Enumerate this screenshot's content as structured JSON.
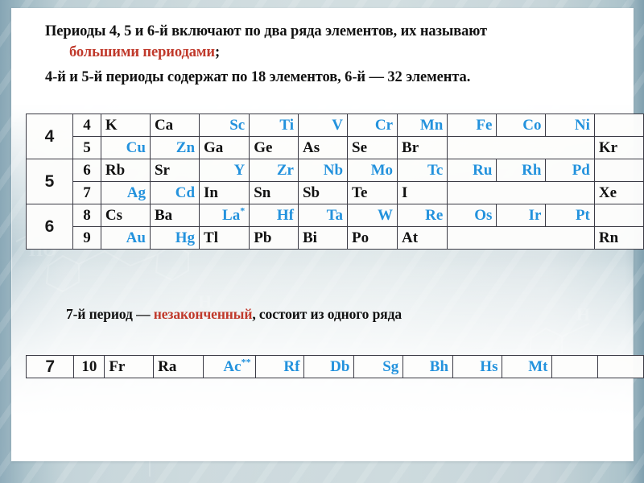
{
  "slide": {
    "colors": {
      "blue_element": "#2392dd",
      "black_element": "#111111",
      "highlight_red": "#c0392b",
      "grid_line": "#3b3b45",
      "background": "#c5d4d8"
    }
  },
  "intro": {
    "line1_a": "Периоды 4, 5 и 6-й включают по два ряда элементов, их называют",
    "line2_red": "большими периодами",
    "line2_tail": ";",
    "line3": "4-й и 5-й периоды содержат по 18 элементов, 6-й — 32 элемента."
  },
  "note7": {
    "prefix": "7-й период — ",
    "red": "незаконченный",
    "suffix": ", состоит из одного ряда"
  },
  "table_main": {
    "periods": [
      "4",
      "5",
      "6"
    ],
    "rows": [
      {
        "period": "4",
        "rownum": "4",
        "cells": [
          {
            "text": "K",
            "color": "black"
          },
          {
            "text": "Ca",
            "color": "black"
          },
          {
            "text": "Sc",
            "color": "blue"
          },
          {
            "text": "Ti",
            "color": "blue"
          },
          {
            "text": "V",
            "color": "blue"
          },
          {
            "text": "Cr",
            "color": "blue"
          },
          {
            "text": "Mn",
            "color": "blue"
          },
          {
            "text": "Fe",
            "color": "blue"
          },
          {
            "text": "Co",
            "color": "blue"
          },
          {
            "text": "Ni",
            "color": "blue"
          },
          {
            "text": "",
            "color": "empty"
          }
        ]
      },
      {
        "period": "",
        "rownum": "5",
        "cells": [
          {
            "text": "Cu",
            "color": "blue"
          },
          {
            "text": "Zn",
            "color": "blue"
          },
          {
            "text": "Ga",
            "color": "black"
          },
          {
            "text": "Ge",
            "color": "black"
          },
          {
            "text": "As",
            "color": "black"
          },
          {
            "text": "Se",
            "color": "black"
          },
          {
            "text": "Br",
            "color": "black"
          },
          {
            "text": "",
            "color": "empty",
            "span": 3
          },
          {
            "text": "Kr",
            "color": "black"
          }
        ]
      },
      {
        "period": "5",
        "rownum": "6",
        "cells": [
          {
            "text": "Rb",
            "color": "black"
          },
          {
            "text": "Sr",
            "color": "black"
          },
          {
            "text": "Y",
            "color": "blue"
          },
          {
            "text": "Zr",
            "color": "blue"
          },
          {
            "text": "Nb",
            "color": "blue"
          },
          {
            "text": "Mo",
            "color": "blue"
          },
          {
            "text": "Tc",
            "color": "blue"
          },
          {
            "text": "Ru",
            "color": "blue"
          },
          {
            "text": "Rh",
            "color": "blue"
          },
          {
            "text": "Pd",
            "color": "blue"
          },
          {
            "text": "",
            "color": "empty"
          }
        ]
      },
      {
        "period": "",
        "rownum": "7",
        "cells": [
          {
            "text": "Ag",
            "color": "blue"
          },
          {
            "text": "Cd",
            "color": "blue"
          },
          {
            "text": "In",
            "color": "black"
          },
          {
            "text": "Sn",
            "color": "black"
          },
          {
            "text": "Sb",
            "color": "black"
          },
          {
            "text": "Te",
            "color": "black"
          },
          {
            "text": "I",
            "color": "black"
          },
          {
            "text": "",
            "color": "empty",
            "span": 3
          },
          {
            "text": "Xe",
            "color": "black"
          }
        ]
      },
      {
        "period": "6",
        "rownum": "8",
        "cells": [
          {
            "text": "Cs",
            "color": "black"
          },
          {
            "text": "Ba",
            "color": "black"
          },
          {
            "text": "La",
            "color": "blue",
            "sup": "*"
          },
          {
            "text": "Hf",
            "color": "blue"
          },
          {
            "text": "Ta",
            "color": "blue"
          },
          {
            "text": "W",
            "color": "blue"
          },
          {
            "text": "Re",
            "color": "blue"
          },
          {
            "text": "Os",
            "color": "blue"
          },
          {
            "text": "Ir",
            "color": "blue"
          },
          {
            "text": "Pt",
            "color": "blue"
          },
          {
            "text": "",
            "color": "empty"
          }
        ]
      },
      {
        "period": "",
        "rownum": "9",
        "cells": [
          {
            "text": "Au",
            "color": "blue"
          },
          {
            "text": "Hg",
            "color": "blue"
          },
          {
            "text": "Tl",
            "color": "black"
          },
          {
            "text": "Pb",
            "color": "black"
          },
          {
            "text": "Bi",
            "color": "black"
          },
          {
            "text": "Po",
            "color": "black"
          },
          {
            "text": "At",
            "color": "black"
          },
          {
            "text": "",
            "color": "empty",
            "span": 3
          },
          {
            "text": "Rn",
            "color": "black"
          }
        ]
      }
    ]
  },
  "table_p7": {
    "rows": [
      {
        "period": "7",
        "rownum": "10",
        "cells": [
          {
            "text": "Fr",
            "color": "black"
          },
          {
            "text": "Ra",
            "color": "black"
          },
          {
            "text": "Ac",
            "color": "blue",
            "sup": "**"
          },
          {
            "text": "Rf",
            "color": "blue"
          },
          {
            "text": "Db",
            "color": "blue"
          },
          {
            "text": "Sg",
            "color": "blue"
          },
          {
            "text": "Bh",
            "color": "blue"
          },
          {
            "text": "Hs",
            "color": "blue"
          },
          {
            "text": "Mt",
            "color": "blue"
          },
          {
            "text": "",
            "color": "empty"
          },
          {
            "text": "",
            "color": "empty"
          }
        ]
      }
    ]
  }
}
